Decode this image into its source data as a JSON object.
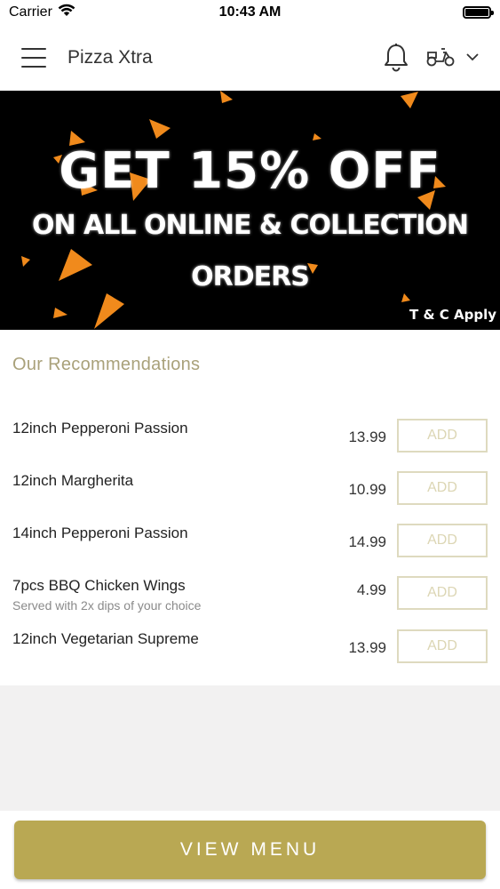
{
  "status_bar": {
    "carrier": "Carrier",
    "time": "10:43 AM"
  },
  "header": {
    "brand": "Pizza Xtra",
    "icons": [
      "menu-icon",
      "bell-icon",
      "scooter-icon",
      "chevron-down-icon"
    ]
  },
  "banner": {
    "line1": "GET 15% OFF",
    "line2": "ON ALL ONLINE & COLLECTION",
    "line3": "ORDERS",
    "tc": "T & C Apply",
    "shard_color": "#f08a1c"
  },
  "recommendations": {
    "title": "Our Recommendations",
    "add_label": "ADD",
    "items": [
      {
        "name": "12inch Pepperoni Passion",
        "subtitle": "",
        "price": "13.99"
      },
      {
        "name": "12inch Margherita",
        "subtitle": "",
        "price": "10.99"
      },
      {
        "name": "14inch Pepperoni Passion",
        "subtitle": "",
        "price": "14.99"
      },
      {
        "name": "7pcs BBQ Chicken Wings",
        "subtitle": "Served with 2x dips of your choice",
        "price": "4.99"
      },
      {
        "name": "12inch Vegetarian Supreme",
        "subtitle": "",
        "price": "13.99"
      }
    ]
  },
  "footer": {
    "view_menu_label": "VIEW MENU"
  },
  "colors": {
    "accent": "#b9a853",
    "title_gold": "#a9a17a",
    "add_border": "#dedabf"
  }
}
